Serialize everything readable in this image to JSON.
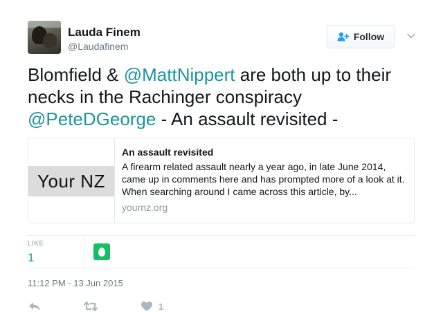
{
  "author": {
    "name": "Lauda Finem",
    "handle": "@Laudafinem"
  },
  "follow_button": {
    "label": "Follow"
  },
  "tweet": {
    "text_1": "Blomfield & ",
    "mention_1": "@MattNippert",
    "text_2": " are both up to their necks in the Rachinger conspiracy ",
    "mention_2": "@PeteDGeorge",
    "text_3": " - An assault revisited -"
  },
  "card": {
    "image_text": "Your NZ",
    "title": "An assault revisited",
    "description": "A firearm related assault nearly a year ago, in late June 2014, came up in comments here and has prompted more of a look at it. When searching around I came across this article, by...",
    "domain": "yournz.org"
  },
  "stats": {
    "like_label": "LIKE",
    "like_count": "1"
  },
  "timestamp": "11:12 PM - 13 Jun 2015",
  "actions": {
    "like_count": "1"
  },
  "colors": {
    "link": "#1b95a0",
    "secondary_text": "#657786",
    "border": "#e1e8ed",
    "liker_avatar": "#17bf63",
    "action_icon": "#aab8c2"
  },
  "icons": [
    "follow-person-plus-icon",
    "chevron-down-icon",
    "reply-icon",
    "retweet-icon",
    "heart-icon",
    "egg-avatar-icon"
  ]
}
